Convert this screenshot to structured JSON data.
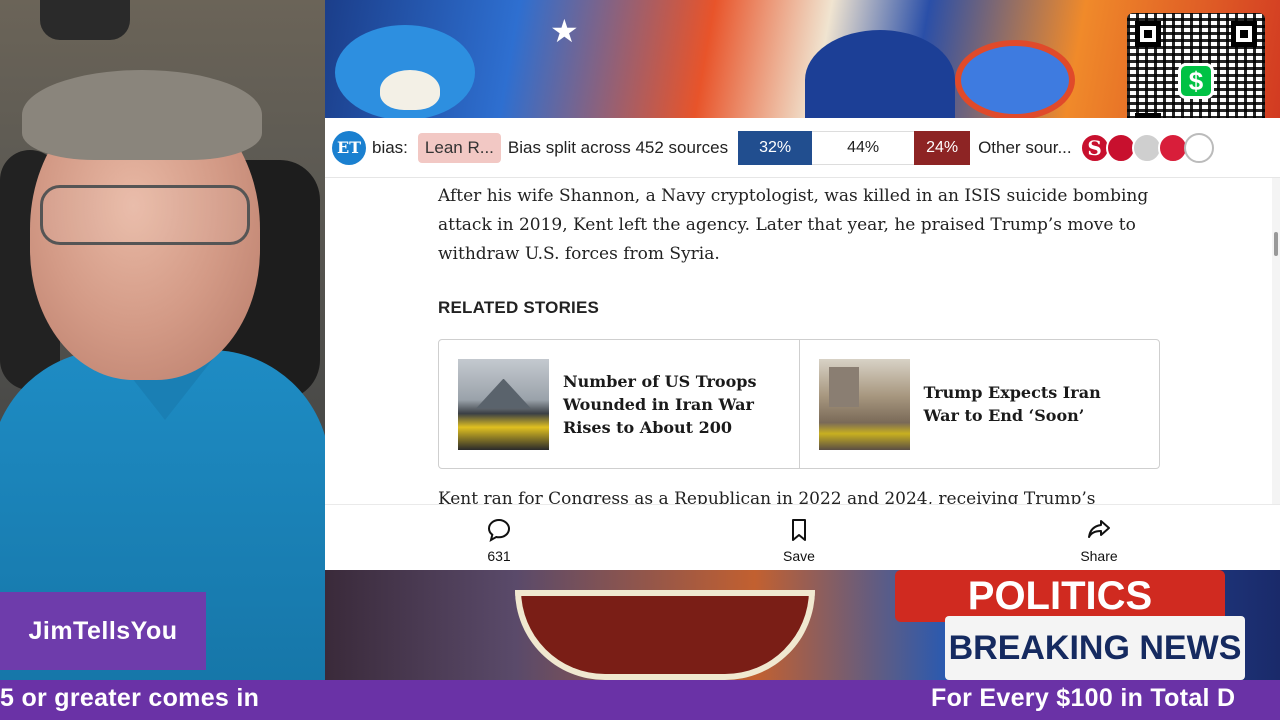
{
  "overlay": {
    "streamer_name": "JimTellsYou",
    "ticker": [
      "5 or greater comes in",
      "For Every $100 in Total D"
    ]
  },
  "bias_bar": {
    "source_logo": "ET",
    "bias_label": "bias:",
    "lean_value": "Lean R...",
    "split_text": "Bias split across 452 sources",
    "left_pct": "32%",
    "center_pct": "44%",
    "right_pct": "24%",
    "other_sources": "Other sour...",
    "source_icons": [
      "S"
    ],
    "colors": {
      "left": "#214e8f",
      "right": "#8d2424",
      "lean": "#f2c8c4"
    }
  },
  "article": {
    "paragraph": "After his wife Shannon, a Navy cryptologist, was killed in an ISIS suicide bombing attack in 2019, Kent left the agency. Later that year, he praised Trump’s move to withdraw U.S. forces from Syria.",
    "related_heading": "RELATED STORIES",
    "related": [
      {
        "title": "Number of US Troops Wounded in Iran War Rises to About 200"
      },
      {
        "title": "Trump Expects Iran War to End ‘Soon’"
      }
    ],
    "cut_line": "Kent ran for Congress as a Republican in 2022 and 2024, receiving Trump’s"
  },
  "actions": {
    "comment_count": "631",
    "save_label": "Save",
    "share_label": "Share"
  },
  "banner": {
    "politics": "POLITICS",
    "breaking": "BREAKING NEWS"
  },
  "qr": {
    "cash_symbol": "$"
  }
}
